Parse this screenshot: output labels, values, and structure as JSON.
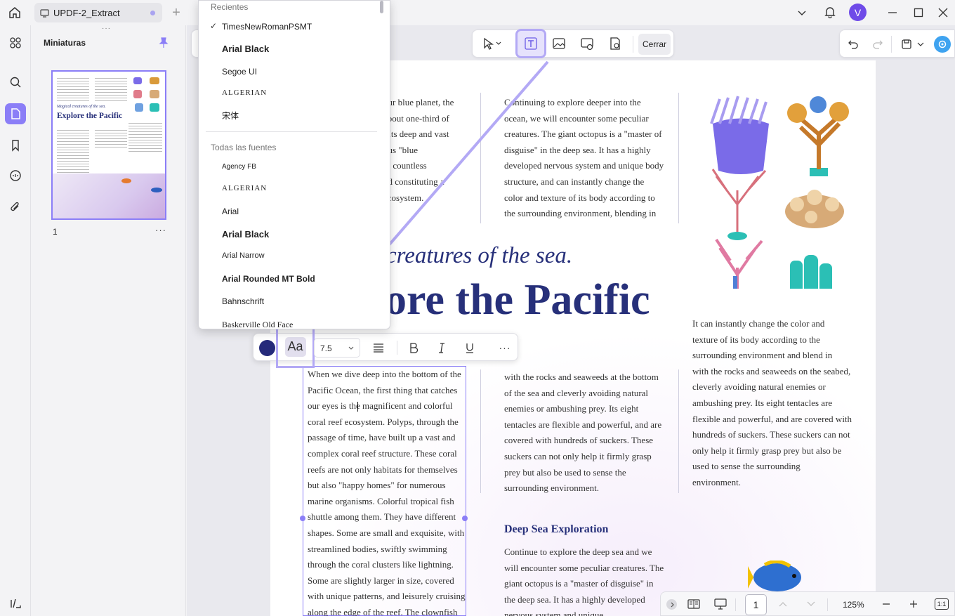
{
  "tab": {
    "title": "UPDF-2_Extract"
  },
  "user": {
    "avatar_letter": "V"
  },
  "thumbnails": {
    "title": "Miniaturas",
    "page_number": "1",
    "more": "···"
  },
  "thumb_preview": {
    "subtitle": "Magical creatures of the sea.",
    "title": "Explore the Pacific"
  },
  "top_toolbar": {
    "close_label": "Cerrar"
  },
  "font_dropdown": {
    "recent_header": "Recientes",
    "recent": [
      "TimesNewRomanPSMT",
      "Arial Black",
      "Segoe UI",
      "ALGERIAN",
      "宋体"
    ],
    "selected": "TimesNewRomanPSMT",
    "all_header": "Todas las fuentes",
    "all": [
      "Agency FB",
      "ALGERIAN",
      "Arial",
      "Arial Black",
      "Arial Narrow",
      "Arial Rounded MT Bold",
      "Bahnschrift",
      "Baskerville Old Face"
    ]
  },
  "format_bar": {
    "font_icon_label": "Aa",
    "font_size": "7.5",
    "more": "···"
  },
  "document": {
    "col1_top": [
      "our blue planet, the",
      "about one-third of",
      ". Its deep and vast",
      "ous \"blue",
      "to countless",
      "nd constituting a",
      "ecosystem."
    ],
    "col2_top": [
      "Continuing to explore deeper into the",
      "ocean, we will encounter some peculiar",
      "creatures. The giant octopus is a \"master of",
      "disguise\" in the deep sea. It has a highly",
      "developed nervous system and unique body",
      "structure, and can instantly change the",
      "color and texture of its body according to",
      "the surrounding environment, blending in"
    ],
    "subtitle": "creatures of the sea.",
    "title": "ore the Pacific",
    "selected_text": [
      "When we dive deep into the bottom of the",
      "Pacific Ocean, the first thing that catches",
      "our eyes is the magnificent and colorful",
      "coral reef ecosystem. Polyps, through the",
      "passage of time, have built up a vast and",
      "complex coral reef structure. These coral",
      "reefs are not only habitats for themselves",
      "but also \"happy homes\" for numerous",
      "marine organisms. Colorful tropical fish",
      "shuttle among them. They have different",
      "shapes. Some are small and exquisite, with",
      "streamlined bodies, swiftly swimming",
      "through the coral clusters like lightning.",
      "Some are slightly larger in size, covered",
      "with unique patterns, and leisurely cruising",
      "along the edge of the reef. The clownfish is"
    ],
    "col2_mid": [
      "with the rocks and seaweeds at the bottom",
      "of the sea and cleverly avoiding natural",
      "enemies or ambushing prey. Its eight",
      "tentacles are flexible and powerful, and are",
      "covered with hundreds of suckers. These",
      "suckers can not only help it firmly grasp",
      "prey but also be used to sense the",
      "surrounding environment."
    ],
    "col3": [
      "It can instantly change the color and",
      "texture of its body according to the",
      "surrounding environment and blend in",
      "with the rocks and seaweeds on the seabed,",
      "cleverly avoiding natural enemies or",
      "ambushing prey. Its eight tentacles are",
      "flexible and powerful, and are covered with",
      "hundreds of suckers. These suckers can not",
      "only help it firmly grasp prey but also be",
      "used to sense the surrounding",
      "environment."
    ],
    "deep_sea_heading": "Deep Sea Exploration",
    "deep_sea_text": [
      "Continue to explore the deep sea and we",
      "will encounter some peculiar creatures. The",
      "giant octopus is a \"master of disguise\" in",
      "the deep sea. It has a highly developed",
      "nervous system and unique"
    ]
  },
  "bottom_bar": {
    "page_input": "1",
    "zoom": "125%",
    "fit_label": "1:1"
  },
  "colors": {
    "accent": "#8b7ef7",
    "text_color_swatch": "#252a7a",
    "title_color": "#27307a"
  }
}
